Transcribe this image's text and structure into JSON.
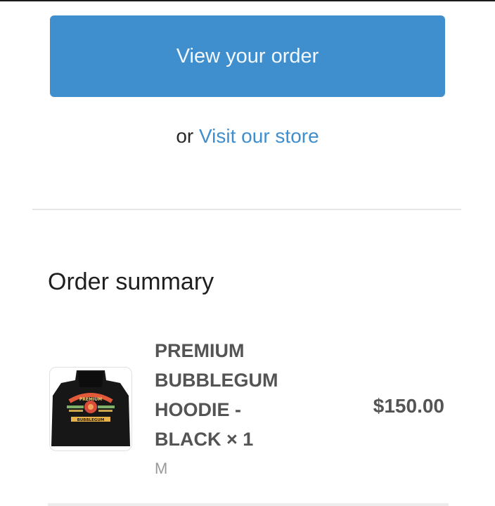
{
  "actions": {
    "view_order_label": "View your order",
    "or_text": "or",
    "visit_store_label": "Visit our store"
  },
  "summary": {
    "title": "Order summary",
    "items": [
      {
        "name_lines": [
          "PREMIUM",
          "BUBBLEGUM",
          "HOODIE -",
          "BLACK × 1"
        ],
        "variant": "M",
        "price": "$150.00",
        "image_icon": "hoodie-product-image",
        "image_text": [
          "PREMIUM",
          "BUBBLEGUM"
        ]
      }
    ]
  },
  "colors": {
    "primary": "#3f8fce",
    "text": "#1f1f1f",
    "muted": "#9a9a9a"
  }
}
